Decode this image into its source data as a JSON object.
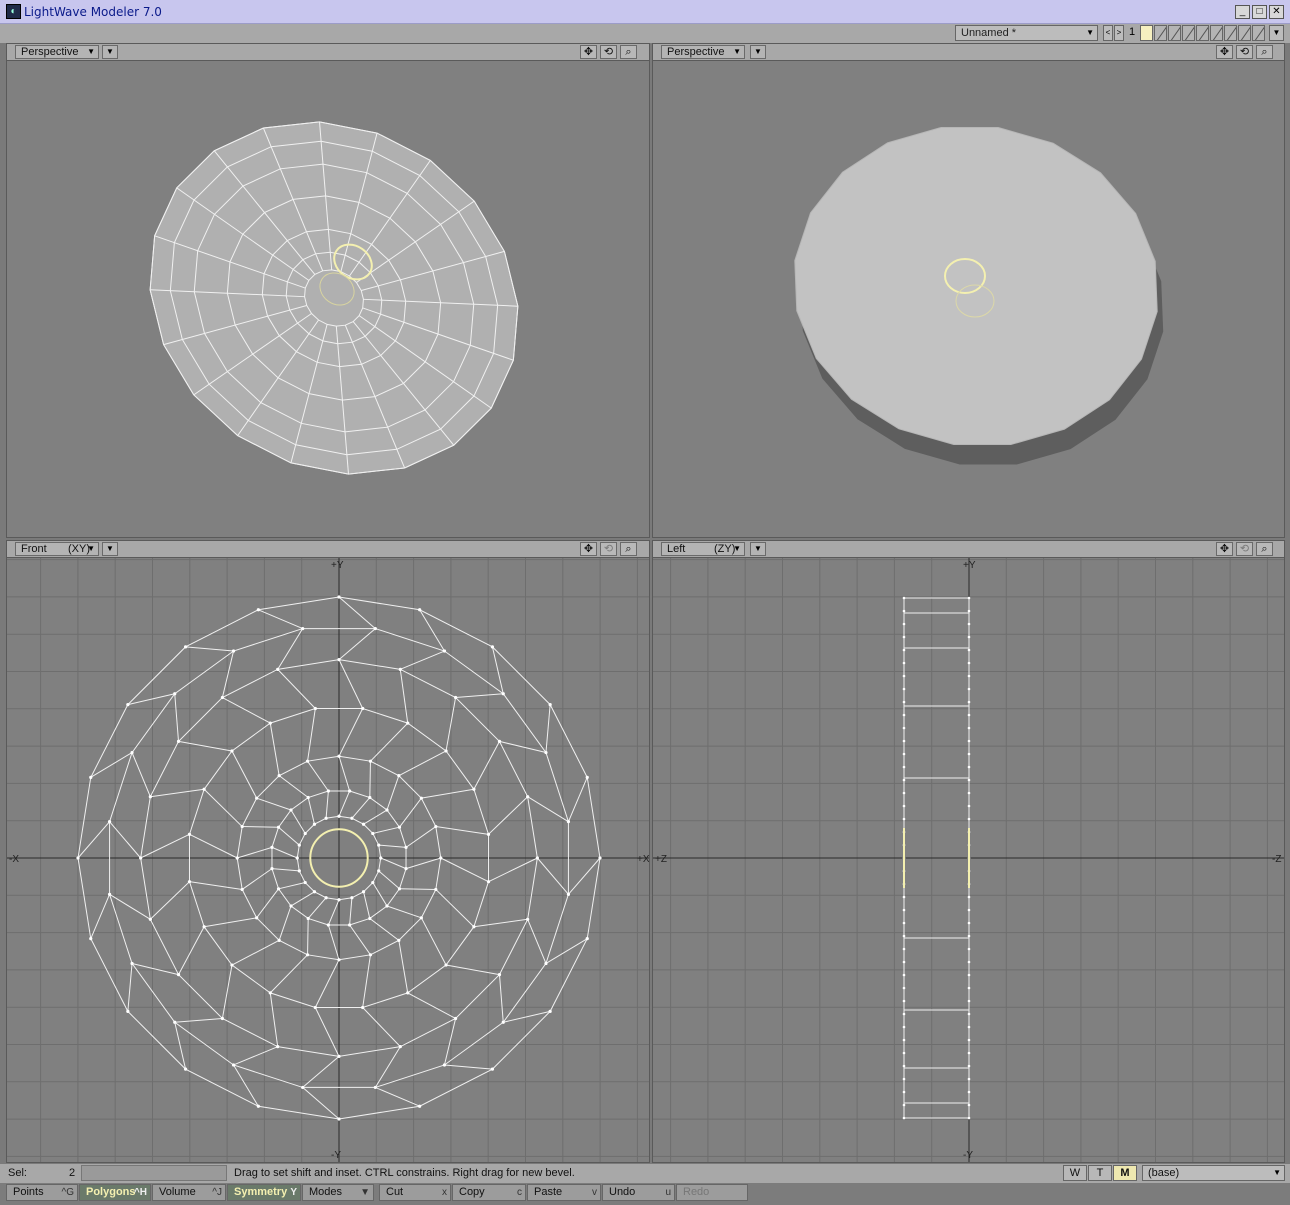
{
  "window": {
    "title": "LightWave Modeler 7.0",
    "buttons": {
      "minimize": "_",
      "maximize": "□",
      "close": "✕"
    }
  },
  "topbar": {
    "layer_object": "Unnamed *",
    "nav_prev": "<",
    "nav_next": ">",
    "layer_number": "1"
  },
  "viewports": [
    {
      "view": "Perspective",
      "axis": ""
    },
    {
      "view": "Perspective",
      "axis": ""
    },
    {
      "view": "Front",
      "axis": "(XY)"
    },
    {
      "view": "Left",
      "axis": "(ZY)"
    }
  ],
  "viewport_controls": {
    "move": "✥",
    "rotate": "⟲",
    "zoom": "⌕"
  },
  "axis_labels": {
    "front": {
      "top": "+Y",
      "bottom": "-Y",
      "left": "-X",
      "right": "+X"
    },
    "left": {
      "top": "+Y",
      "bottom": "-Y",
      "left": "+Z",
      "right": "-Z"
    }
  },
  "status": {
    "sel_label": "Sel:",
    "sel_count": "2",
    "message": "Drag to set shift and inset. CTRL constrains. Right drag for new bevel.",
    "w": "W",
    "t": "T",
    "m": "M",
    "layer_name": "(base)"
  },
  "toolbar": [
    {
      "label": "Points",
      "key": "^G"
    },
    {
      "label": "Polygons",
      "key": "^H"
    },
    {
      "label": "Volume",
      "key": "^J"
    },
    {
      "label": "Symmetry",
      "key": "Y"
    },
    {
      "label": "Modes",
      "key": "▼"
    },
    {
      "label": "Cut",
      "key": "x"
    },
    {
      "label": "Copy",
      "key": "c"
    },
    {
      "label": "Paste",
      "key": "v"
    },
    {
      "label": "Undo",
      "key": "u"
    },
    {
      "label": "Redo",
      "key": ""
    }
  ],
  "colors": {
    "viewport_bg": "#808080",
    "wire": "#f0f0f0",
    "selection": "#f4f0b0",
    "grid": "#6e6e6e"
  }
}
